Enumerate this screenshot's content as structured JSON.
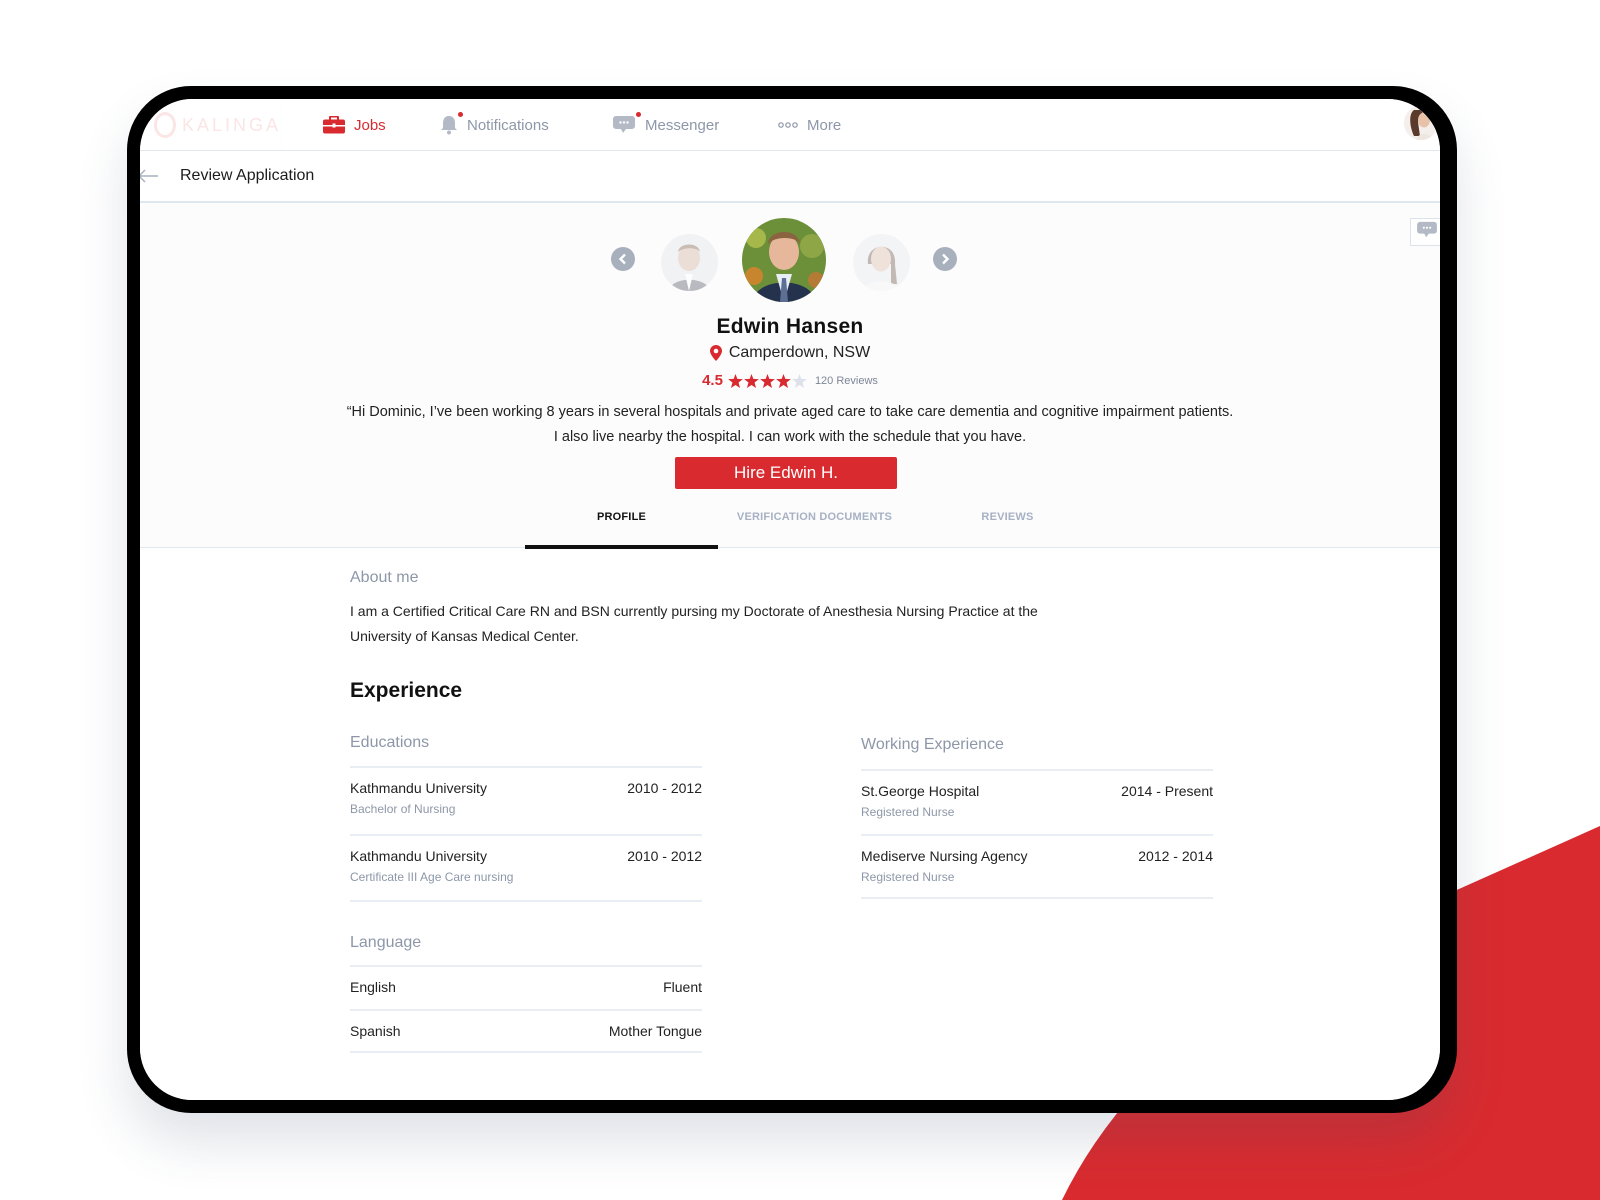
{
  "app": {
    "logo_text": "KALINGA",
    "accent_color": "#d92b2f"
  },
  "nav": {
    "items": [
      {
        "label": "Jobs",
        "icon": "briefcase-icon",
        "active": true,
        "badge": false
      },
      {
        "label": "Notifications",
        "icon": "bell-icon",
        "active": false,
        "badge": true
      },
      {
        "label": "Messenger",
        "icon": "chat-bubble-icon",
        "active": false,
        "badge": true
      },
      {
        "label": "More",
        "icon": "more-dots-icon",
        "active": false,
        "badge": false
      }
    ]
  },
  "subheader": {
    "title": "Review Application"
  },
  "applicant": {
    "name": "Edwin Hansen",
    "location": "Camperdown, NSW",
    "rating": "4.5",
    "rating_value": 4.5,
    "rating_max": 5,
    "reviews": "120 Reviews",
    "quote_line1": "“Hi Dominic, I’ve been working 8 years in several hospitals and private aged care to take care dementia and cognitive impairment patients.",
    "quote_line2": "I also live nearby the hospital. I can work with the schedule that you have.",
    "hire_label": "Hire Edwin H."
  },
  "tabs": [
    {
      "label": "PROFILE",
      "active": true
    },
    {
      "label": "VERIFICATION DOCUMENTS",
      "active": false
    },
    {
      "label": "REVIEWS",
      "active": false
    }
  ],
  "about": {
    "label": "About me",
    "text": "I am a Certified Critical Care RN and BSN currently pursing my Doctorate of Anesthesia Nursing Practice at the University of Kansas Medical Center."
  },
  "experience": {
    "title": "Experience",
    "educations": {
      "label": "Educations",
      "items": [
        {
          "name": "Kathmandu University",
          "detail": "Bachelor of Nursing",
          "years": "2010 - 2012"
        },
        {
          "name": "Kathmandu University",
          "detail": "Certificate III Age Care nursing",
          "years": "2010 - 2012"
        }
      ]
    },
    "working": {
      "label": "Working Experience",
      "items": [
        {
          "name": "St.George Hospital",
          "detail": "Registered Nurse",
          "years": "2014 - Present"
        },
        {
          "name": "Mediserve Nursing Agency",
          "detail": "Registered Nurse",
          "years": "2012 - 2014"
        }
      ]
    },
    "language": {
      "label": "Language",
      "items": [
        {
          "name": "English",
          "level": "Fluent"
        },
        {
          "name": "Spanish",
          "level": "Mother Tongue"
        }
      ]
    }
  }
}
